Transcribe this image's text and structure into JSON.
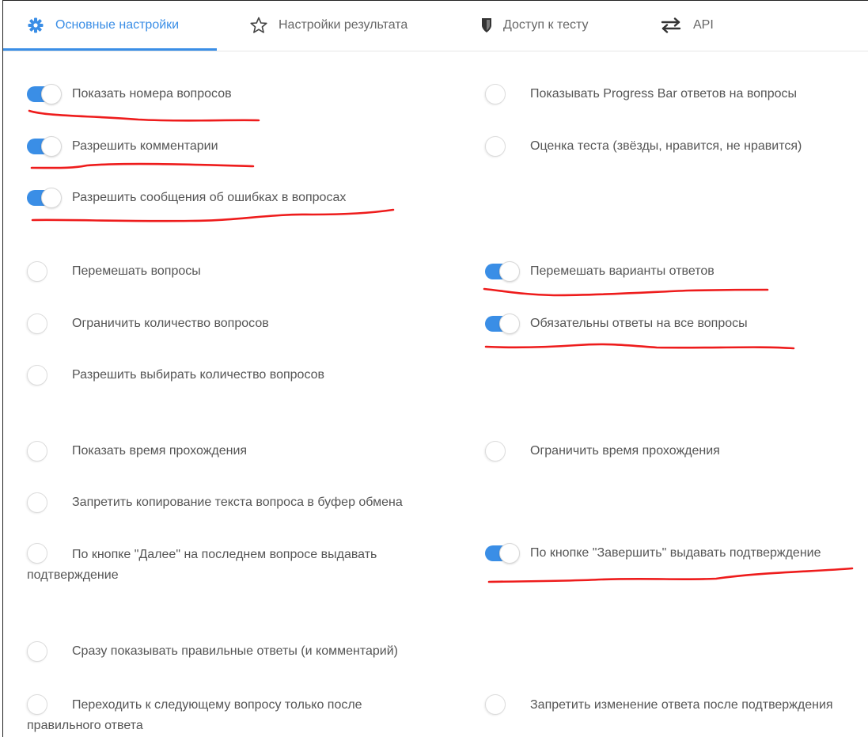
{
  "tabs": [
    {
      "label": "Основные настройки",
      "icon": "gear-icon",
      "active": true
    },
    {
      "label": "Настройки результата",
      "icon": "star-icon",
      "active": false
    },
    {
      "label": "Доступ к тесту",
      "icon": "shield-icon",
      "active": false
    },
    {
      "label": "API",
      "icon": "swap-arrows-icon",
      "active": false
    }
  ],
  "options": {
    "show_question_numbers": {
      "label": "Показать номера вопросов",
      "on": true
    },
    "progress_bar": {
      "label": "Показывать Progress Bar ответов на вопросы",
      "on": false
    },
    "allow_comments": {
      "label": "Разрешить комментарии",
      "on": true
    },
    "test_rating": {
      "label": "Оценка теста (звёзды, нравится, не нравится)",
      "on": false
    },
    "error_reports": {
      "label": "Разрешить сообщения об ошибках в вопросах",
      "on": true
    },
    "shuffle_questions": {
      "label": "Перемешать вопросы",
      "on": false
    },
    "shuffle_answers": {
      "label": "Перемешать варианты ответов",
      "on": true
    },
    "limit_questions": {
      "label": "Ограничить количество вопросов",
      "on": false
    },
    "required_answers": {
      "label": "Обязательны ответы на все вопросы",
      "on": true
    },
    "choose_question_count": {
      "label": "Разрешить выбирать количество вопросов",
      "on": false
    },
    "show_time": {
      "label": "Показать время прохождения",
      "on": false
    },
    "limit_time": {
      "label": "Ограничить время прохождения",
      "on": false
    },
    "prevent_copy": {
      "label": "Запретить копирование текста вопроса в буфер обмена",
      "on": false
    },
    "next_confirm": {
      "label": "По кнопке \"Далее\" на последнем вопросе выдавать подтверждение",
      "on": false
    },
    "finish_confirm": {
      "label": "По кнопке \"Завершить\" выдавать подтверждение",
      "on": true
    },
    "show_correct": {
      "label": "Сразу показывать правильные ответы (и комментарий)",
      "on": false
    },
    "next_after_correct": {
      "label": "Переходить к следующему вопросу только после правильного ответа",
      "on": false
    },
    "prevent_answer_change": {
      "label": "Запретить изменение ответа после подтверждения",
      "on": false
    }
  },
  "colors": {
    "accent": "#3a8ee6",
    "annotation": "#ee1c1c"
  }
}
